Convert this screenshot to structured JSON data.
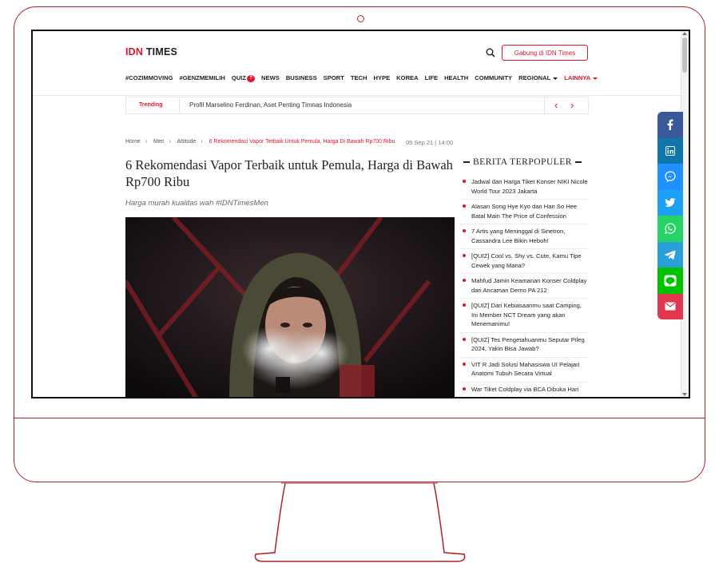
{
  "header": {
    "logo_idn": "IDN",
    "logo_times": "TIMES",
    "join_button": "Gabung di IDN Times"
  },
  "nav": {
    "items": [
      "#COZIMMOVING",
      "#GENZMEMILIH",
      "QUIZ",
      "NEWS",
      "BUSINESS",
      "SPORT",
      "TECH",
      "HYPE",
      "KOREA",
      "LIFE",
      "HEALTH",
      "COMMUNITY",
      "REGIONAL",
      "LAINNYA"
    ]
  },
  "trending": {
    "label": "Trending",
    "text": "Profil Marselino Ferdinan, Aset Penting Timnas Indonesia"
  },
  "breadcrumb": {
    "items": [
      "Home",
      "Men",
      "Attitude"
    ],
    "current": "6 Rekomendasi Vapor Terbaik Untuk Pemula, Harga Di Bawah Rp700 Ribu"
  },
  "article": {
    "date": "05 Sep 21 | 14:00",
    "title": "6 Rekomendasi Vapor Terbaik untuk Pemula, Harga di Bawah Rp700 Ribu",
    "subtitle": "Harga murah kualitas wah #IDNTimesMen"
  },
  "popular": {
    "heading": "BERITA TERPOPULER",
    "items": [
      "Jadwal dan Harga Tiket Konser NIKI Nicole World Tour 2023 Jakarta",
      "Alasan Song Hye Kyo dan Han So Hee Batal Main The Price of Confession",
      "7 Artis yang Meninggal di Sinetron, Cassandra Lee Bikin Heboh!",
      "[QUIZ] Cool vs. Shy vs. Cute, Kamu Tipe Cewek yang Mana?",
      "Mahfud Jamin Keamanan Konser Coldplay dari Ancaman Demo PA 212",
      "[QUIZ] Dari Kebiasaanmu saat Camping, Ini Member NCT Dream yang akan Menemanimu!",
      "[QUIZ] Tes Pengetahuanmu Seputar Pileg 2024, Yakin Bisa Jawab?",
      "VIT R Jadi Solusi Mahasiswa UI Pelajari Anatomi Tubuh Secara Virtual",
      "War Tiket Coldplay via BCA Dibuka Hari"
    ]
  },
  "share": {
    "buttons": [
      {
        "icon": "facebook-icon",
        "color": "#3b5998"
      },
      {
        "icon": "linkedin-icon",
        "color": "#0e76a8"
      },
      {
        "icon": "messenger-icon",
        "color": "#1e90ff"
      },
      {
        "icon": "twitter-icon",
        "color": "#1da1f2"
      },
      {
        "icon": "whatsapp-icon",
        "color": "#25d366"
      },
      {
        "icon": "telegram-icon",
        "color": "#2a9fd8"
      },
      {
        "icon": "line-icon",
        "color": "#00c300"
      },
      {
        "icon": "email-icon",
        "color": "#e0374f"
      }
    ]
  },
  "colors": {
    "brand_red": "#e0162b",
    "frame_red": "#b0202a"
  }
}
